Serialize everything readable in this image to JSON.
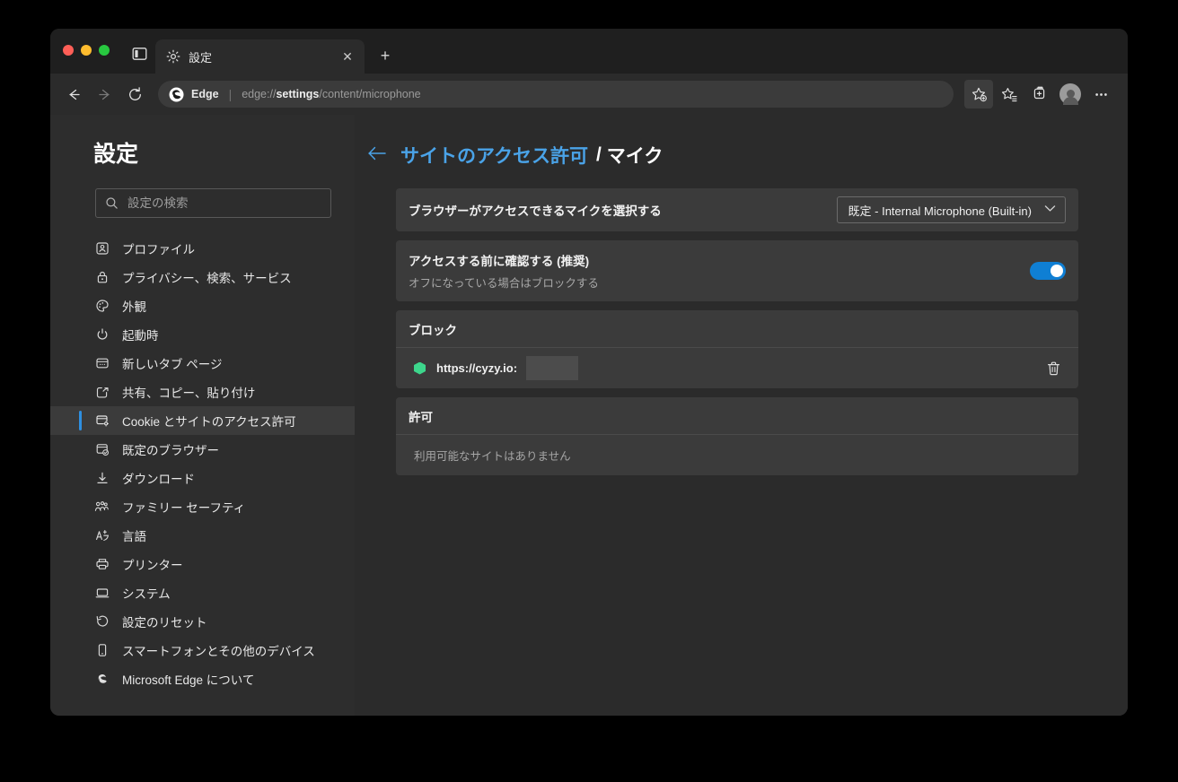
{
  "window": {
    "traffic_lights": [
      "close",
      "minimize",
      "maximize"
    ]
  },
  "tabstrip": {
    "sidebar_toggle_icon": "panel-left-icon",
    "tab": {
      "favicon": "gear-icon",
      "title": "設定",
      "close_label": "✕"
    },
    "new_tab_label": "+"
  },
  "toolbar": {
    "back_icon": "arrow-left-icon",
    "forward_icon": "arrow-right-icon",
    "reload_icon": "reload-icon",
    "brand": "Edge",
    "separator": "|",
    "url_prefix": "edge://",
    "url_bold": "settings",
    "url_suffix": "/content/microphone",
    "full_url": "edge://settings/content/microphone",
    "add_favorite_icon": "star-plus-icon",
    "favorites_icon": "favorites-star-list-icon",
    "collections_icon": "collections-add-icon",
    "profile_icon": "avatar-icon",
    "more_icon": "ellipsis-icon"
  },
  "sidebar": {
    "title": "設定",
    "search": {
      "placeholder": "設定の検索",
      "value": "",
      "icon": "search-icon"
    },
    "items": [
      {
        "label": "プロファイル",
        "icon": "profile-icon",
        "selected": false
      },
      {
        "label": "プライバシー、検索、サービス",
        "icon": "lock-icon",
        "selected": false
      },
      {
        "label": "外観",
        "icon": "palette-icon",
        "selected": false
      },
      {
        "label": "起動時",
        "icon": "power-icon",
        "selected": false
      },
      {
        "label": "新しいタブ ページ",
        "icon": "new-tab-page-icon",
        "selected": false
      },
      {
        "label": "共有、コピー、貼り付け",
        "icon": "share-icon",
        "selected": false
      },
      {
        "label": "Cookie とサイトのアクセス許可",
        "icon": "cookie-permissions-icon",
        "selected": true
      },
      {
        "label": "既定のブラウザー",
        "icon": "default-browser-icon",
        "selected": false
      },
      {
        "label": "ダウンロード",
        "icon": "download-icon",
        "selected": false
      },
      {
        "label": "ファミリー セーフティ",
        "icon": "family-safety-icon",
        "selected": false
      },
      {
        "label": "言語",
        "icon": "language-icon",
        "selected": false
      },
      {
        "label": "プリンター",
        "icon": "printer-icon",
        "selected": false
      },
      {
        "label": "システム",
        "icon": "system-icon",
        "selected": false
      },
      {
        "label": "設定のリセット",
        "icon": "reset-icon",
        "selected": false
      },
      {
        "label": "スマートフォンとその他のデバイス",
        "icon": "phone-icon",
        "selected": false
      },
      {
        "label": "Microsoft Edge について",
        "icon": "edge-logo-icon",
        "selected": false
      }
    ],
    "accent_color": "#2e8fe0",
    "selected_bg": "#3b3b3b"
  },
  "content": {
    "breadcrumb": {
      "back_icon": "arrow-left-icon",
      "parent": "サイトのアクセス許可",
      "separator": "/",
      "current": "マイク",
      "link_color": "#4aa3e8"
    },
    "device_card": {
      "label": "ブラウザーがアクセスできるマイクを選択する",
      "select_value": "既定 - Internal Microphone (Built-in)",
      "chevron_icon": "chevron-down-icon"
    },
    "ask_card": {
      "label": "アクセスする前に確認する (推奨)",
      "sublabel": "オフになっている場合はブロックする",
      "toggle_on": true,
      "toggle_color": "#0f7fd4"
    },
    "blocked_section": {
      "heading": "ブロック",
      "rows": [
        {
          "favicon": "green-hexagon-icon",
          "favicon_color": "#3dd68c",
          "url": "https://cyzy.io:",
          "redacted": true,
          "delete_icon": "trash-icon"
        }
      ]
    },
    "allowed_section": {
      "heading": "許可",
      "empty_text": "利用可能なサイトはありません",
      "rows": []
    }
  }
}
